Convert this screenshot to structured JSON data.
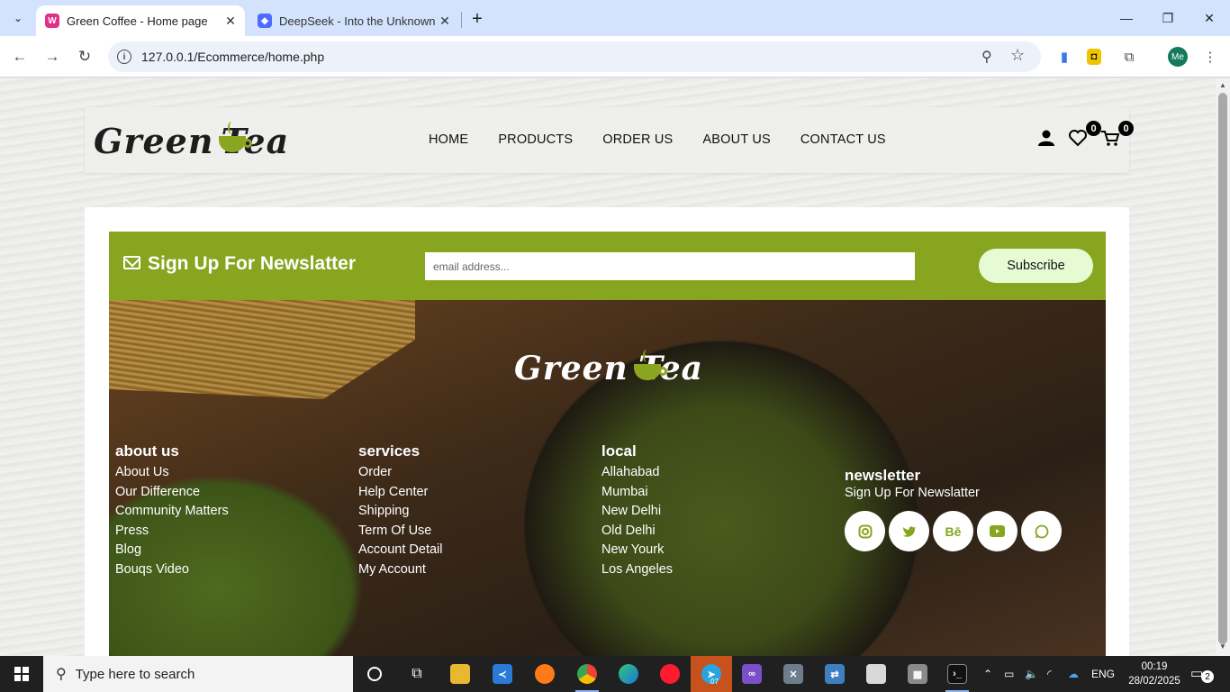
{
  "browser": {
    "tabs": [
      {
        "title": "Green Coffee - Home page",
        "active": true
      },
      {
        "title": "DeepSeek - Into the Unknown",
        "active": false
      }
    ],
    "url": "127.0.0.1/Ecommerce/home.php",
    "profile_initials": "Me"
  },
  "site": {
    "logo_left": "Green",
    "logo_right": "Tea",
    "nav": [
      "HOME",
      "PRODUCTS",
      "ORDER US",
      "ABOUT US",
      "CONTACT US"
    ],
    "wishlist_count": "0",
    "cart_count": "0"
  },
  "newsletter_bar": {
    "title": "Sign Up For Newslatter",
    "email_placeholder": "email address...",
    "subscribe_label": "Subscribe"
  },
  "footer": {
    "logo_left": "Green",
    "logo_right": "Tea",
    "columns": [
      {
        "heading": "about us",
        "links": [
          "About Us",
          "Our Difference",
          "Community Matters",
          "Press",
          "Blog",
          "Bouqs Video"
        ]
      },
      {
        "heading": "services",
        "links": [
          "Order",
          "Help Center",
          "Shipping",
          "Term Of Use",
          "Account Detail",
          "My Account"
        ]
      },
      {
        "heading": "local",
        "links": [
          "Allahabad",
          "Mumbai",
          "New Delhi",
          "Old Delhi",
          "New Yourk",
          "Los Angeles"
        ]
      }
    ],
    "newsletter": {
      "heading": "newsletter",
      "text": "Sign Up For Newslatter",
      "socials": [
        "instagram-icon",
        "twitter-icon",
        "behance-icon",
        "youtube-icon",
        "whatsapp-icon"
      ]
    }
  },
  "taskbar": {
    "search_placeholder": "Type here to search",
    "language": "ENG",
    "time": "00:19",
    "date": "28/02/2025",
    "notifications": "2",
    "telegram_badge": "07"
  },
  "colors": {
    "brand_green": "#87a51f",
    "subscribe_bg": "#e6fbd4",
    "tab_strip": "#d3e3fd"
  }
}
